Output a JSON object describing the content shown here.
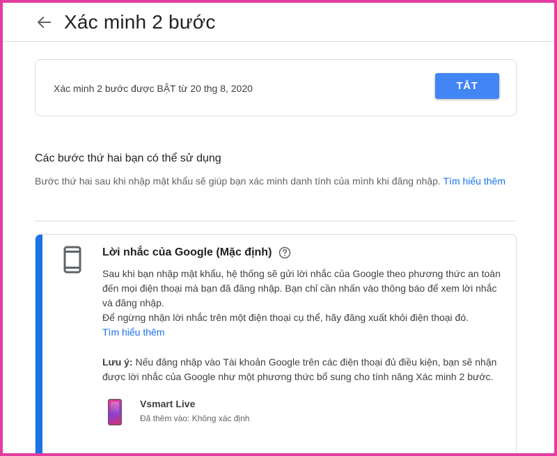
{
  "header": {
    "title": "Xác minh 2 bước",
    "back_icon": "arrow-back-icon"
  },
  "status": {
    "text": "Xác minh 2 bước được BẬT từ 20 thg 8, 2020",
    "off_button_label": "TẮT"
  },
  "second_steps": {
    "title": "Các bước thứ hai bạn có thể sử dụng",
    "description": "Bước thứ hai sau khi nhập mật khẩu sẽ giúp bạn xác minh danh tính của mình khi đăng nhập.",
    "learn_more": "Tìm hiểu thêm"
  },
  "google_prompt": {
    "icon": "smartphone-icon",
    "title": "Lời nhắc của Google (Mặc định)",
    "help_icon": "help-circle-icon",
    "body_1": "Sau khi bạn nhập mật khẩu, hệ thống sẽ gửi lời nhắc của Google theo phương thức an toàn đến mọi điện thoại mà bạn đã đăng nhập. Bạn chỉ cần nhấn vào thông báo để xem lời nhắc và đăng nhập.",
    "body_2": "Để ngừng nhận lời nhắc trên một điện thoại cụ thể, hãy đăng xuất khỏi điện thoại đó.",
    "learn_more": "Tìm hiểu thêm",
    "note_label": "Lưu ý:",
    "note_text": "Nếu đăng nhập vào Tài khoản Google trên các điện thoại đủ điều kiện, bạn sẽ nhận được lời nhắc của Google như một phương thức bổ sung cho tính năng Xác minh 2 bước.",
    "device": {
      "name": "Vsmart Live",
      "added": "Đã thêm vào: Không xác định"
    }
  },
  "colors": {
    "accent": "#1a73e8",
    "button": "#4285f4",
    "frame": "#e53ca0"
  }
}
